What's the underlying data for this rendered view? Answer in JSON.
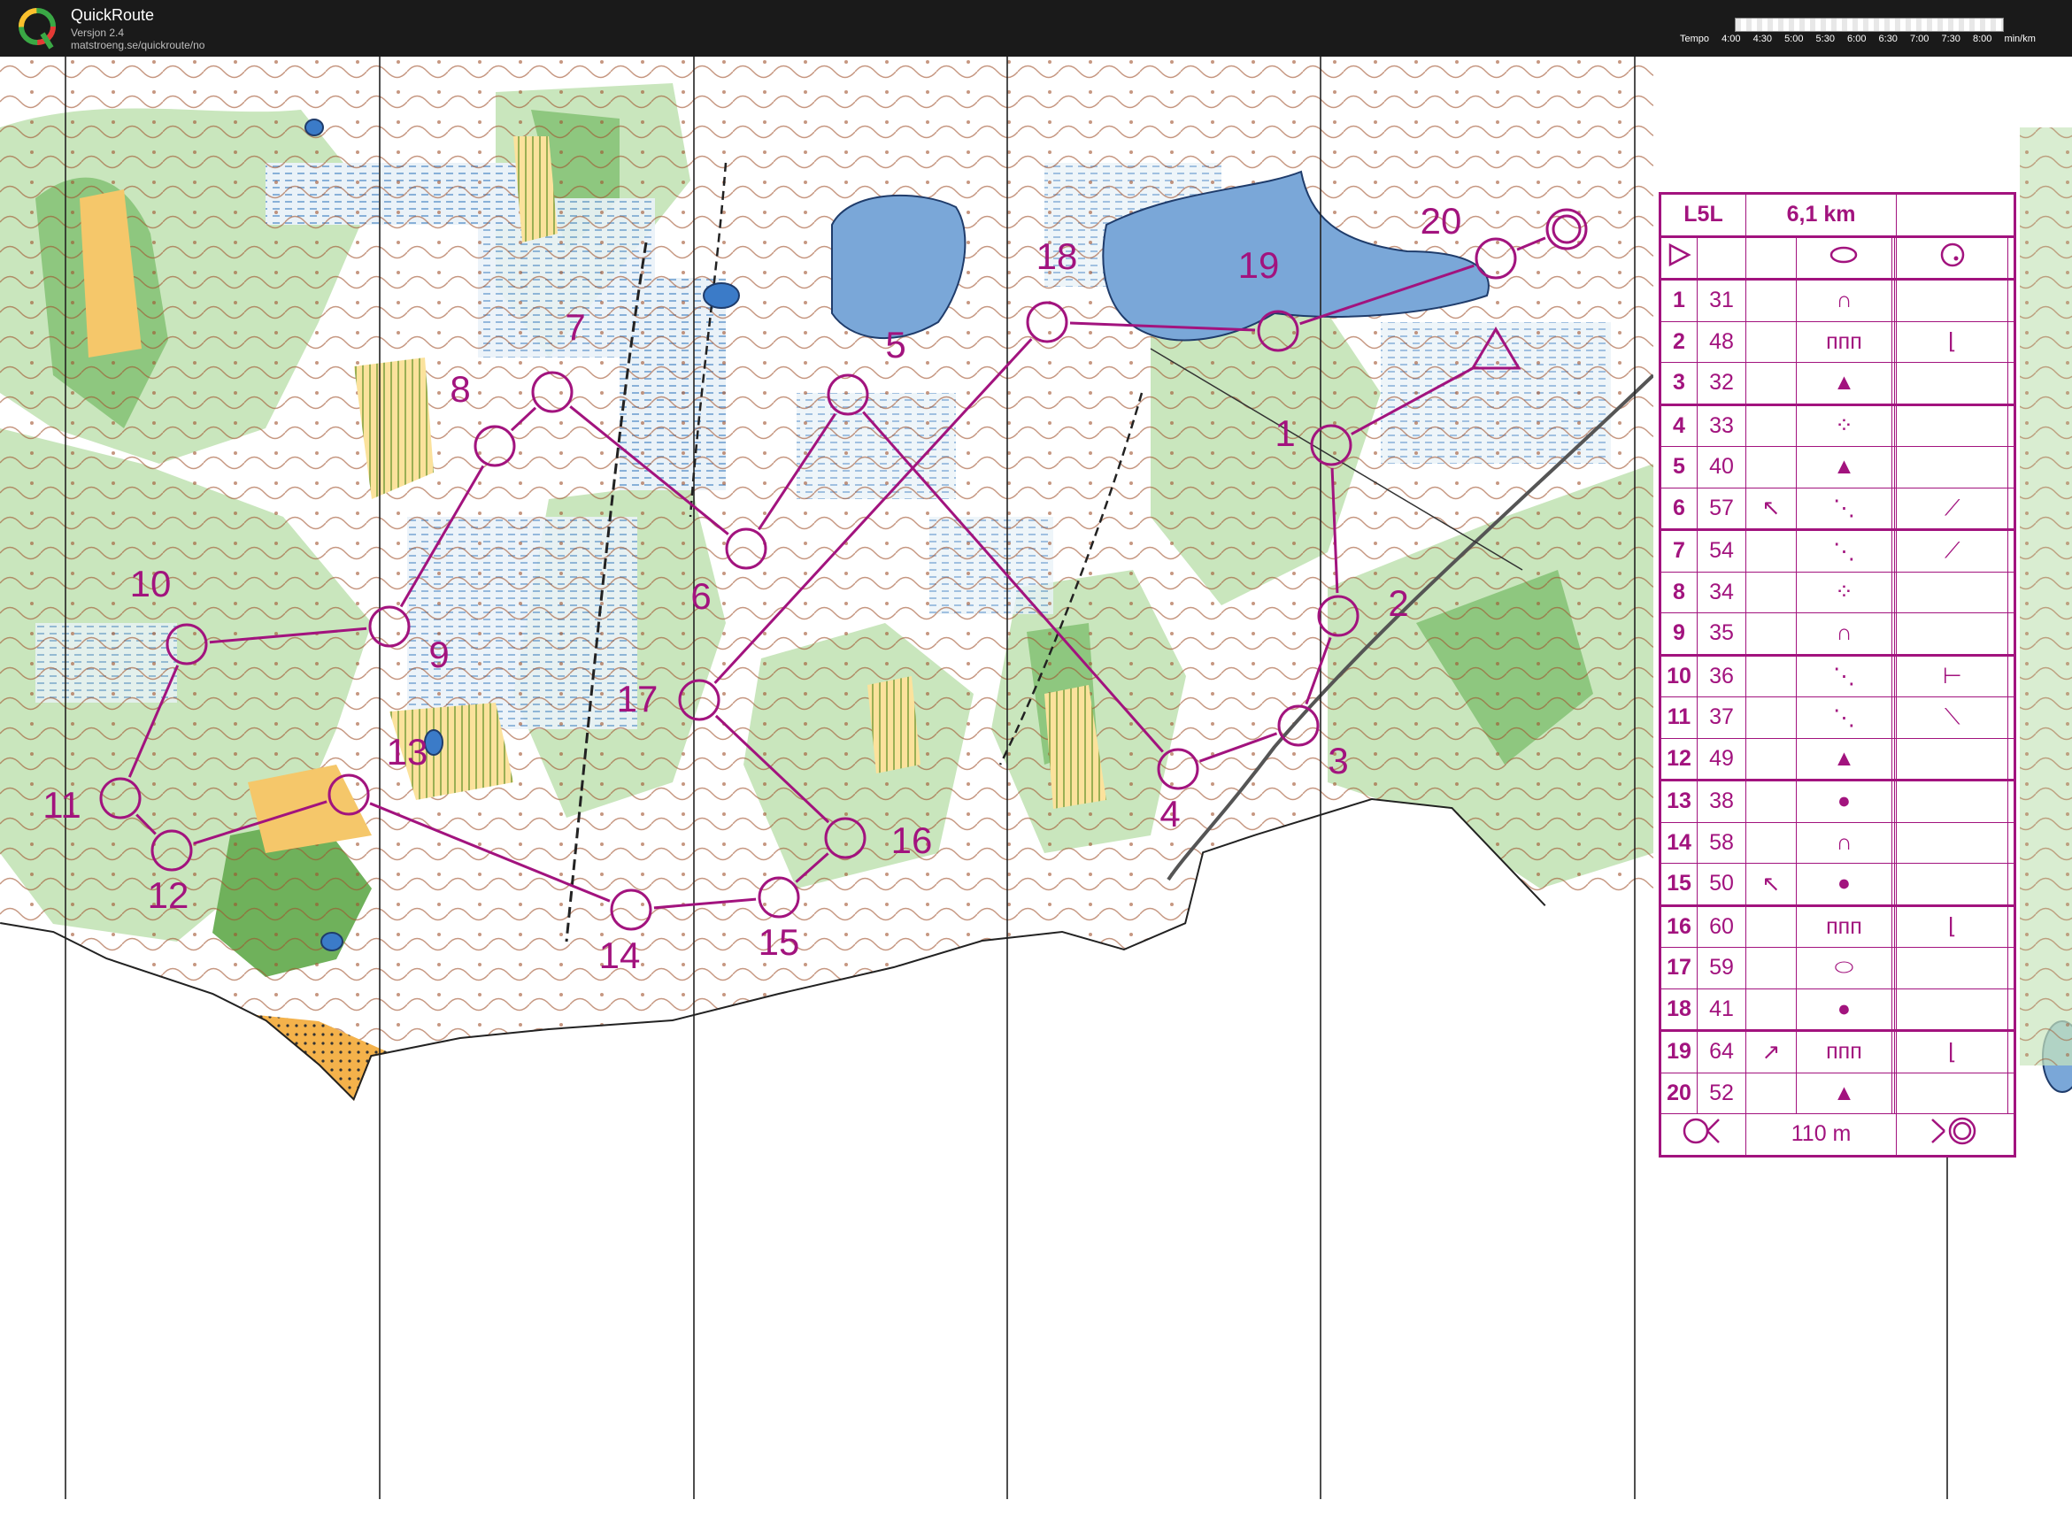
{
  "app": {
    "title": "QuickRoute",
    "version": "Versjon 2.4",
    "url": "matstroeng.se/quickroute/no",
    "logo_letter": "Q"
  },
  "tempo": {
    "label": "Tempo",
    "values": [
      "4:00",
      "4:30",
      "5:00",
      "5:30",
      "6:00",
      "6:30",
      "7:00",
      "7:30",
      "8:00"
    ],
    "unit": "min/km"
  },
  "colors": {
    "course": "#a2137e",
    "water": "#7aa7d8",
    "forest_green": "#8ec77f",
    "open_yellow": "#f5c76a",
    "contour": "#a0522d"
  },
  "map_controls": [
    {
      "label": "1"
    },
    {
      "label": "2"
    },
    {
      "label": "3"
    },
    {
      "label": "4"
    },
    {
      "label": "5"
    },
    {
      "label": "6"
    },
    {
      "label": "7"
    },
    {
      "label": "8"
    },
    {
      "label": "9"
    },
    {
      "label": "10"
    },
    {
      "label": "11"
    },
    {
      "label": "12"
    },
    {
      "label": "13"
    },
    {
      "label": "14"
    },
    {
      "label": "15"
    },
    {
      "label": "16"
    },
    {
      "label": "17"
    },
    {
      "label": "18"
    },
    {
      "label": "19"
    },
    {
      "label": "20"
    }
  ],
  "control_descriptions": {
    "class": "L5L",
    "length": "6,1 km",
    "start_symbol": "triangle-icon",
    "start_feature": "ellipse-icon",
    "start_detail": "circle-icon",
    "controls": [
      {
        "num": "1",
        "code": "31",
        "dir": "",
        "feature": "∩",
        "detail": ""
      },
      {
        "num": "2",
        "code": "48",
        "dir": "",
        "feature": "ᴨᴨᴨ",
        "detail": "⌊"
      },
      {
        "num": "3",
        "code": "32",
        "dir": "",
        "feature": "▲",
        "detail": ""
      },
      {
        "num": "4",
        "code": "33",
        "dir": "",
        "feature": "⁘",
        "detail": ""
      },
      {
        "num": "5",
        "code": "40",
        "dir": "",
        "feature": "▲",
        "detail": ""
      },
      {
        "num": "6",
        "code": "57",
        "dir": "↖",
        "feature": "⋱",
        "detail": "⟋"
      },
      {
        "num": "7",
        "code": "54",
        "dir": "",
        "feature": "⋱",
        "detail": "⟋"
      },
      {
        "num": "8",
        "code": "34",
        "dir": "",
        "feature": "⁘",
        "detail": ""
      },
      {
        "num": "9",
        "code": "35",
        "dir": "",
        "feature": "∩",
        "detail": ""
      },
      {
        "num": "10",
        "code": "36",
        "dir": "",
        "feature": "⋱",
        "detail": "⊢"
      },
      {
        "num": "11",
        "code": "37",
        "dir": "",
        "feature": "⋱",
        "detail": "⟍"
      },
      {
        "num": "12",
        "code": "49",
        "dir": "",
        "feature": "▲",
        "detail": ""
      },
      {
        "num": "13",
        "code": "38",
        "dir": "",
        "feature": "●",
        "detail": ""
      },
      {
        "num": "14",
        "code": "58",
        "dir": "",
        "feature": "∩",
        "detail": ""
      },
      {
        "num": "15",
        "code": "50",
        "dir": "↖",
        "feature": "●",
        "detail": ""
      },
      {
        "num": "16",
        "code": "60",
        "dir": "",
        "feature": "ᴨᴨᴨ",
        "detail": "⌊"
      },
      {
        "num": "17",
        "code": "59",
        "dir": "",
        "feature": "⬭",
        "detail": ""
      },
      {
        "num": "18",
        "code": "41",
        "dir": "",
        "feature": "●",
        "detail": ""
      },
      {
        "num": "19",
        "code": "64",
        "dir": "↗",
        "feature": "ᴨᴨᴨ",
        "detail": "⌊"
      },
      {
        "num": "20",
        "code": "52",
        "dir": "",
        "feature": "▲",
        "detail": ""
      }
    ],
    "finish_text": "110 m"
  }
}
